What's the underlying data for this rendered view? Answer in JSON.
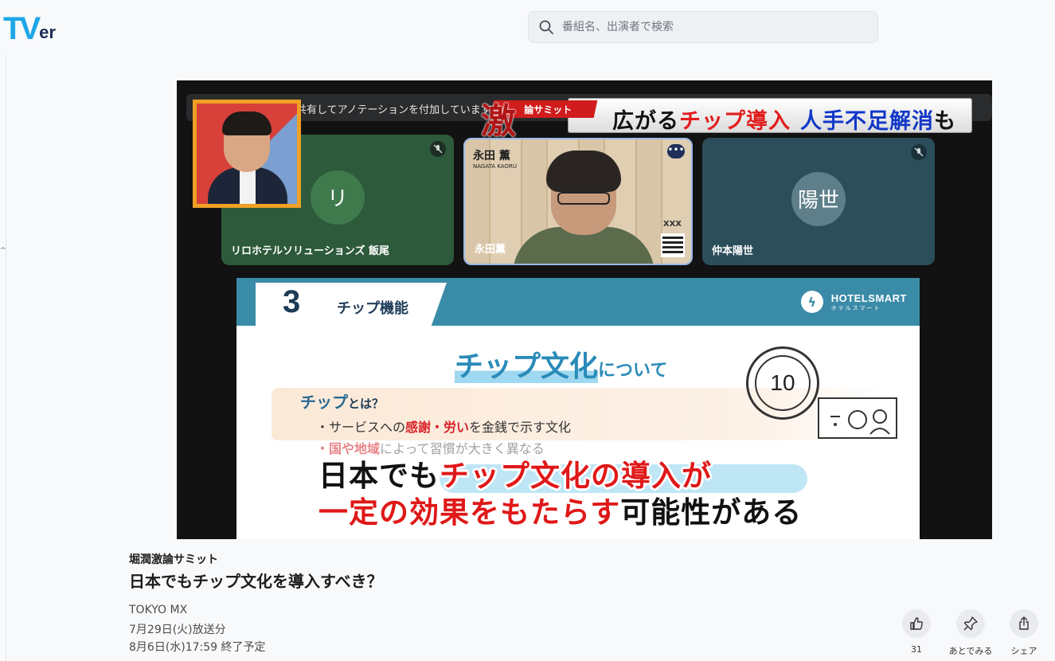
{
  "header": {
    "logo": {
      "t": "T",
      "v": "V",
      "er": "er"
    },
    "search": {
      "placeholder": "番組名、出演者で検索"
    }
  },
  "player": {
    "share_note": "共有してアノテーションを付加しています",
    "banner": {
      "badge": "論サミット",
      "kanji": "激",
      "part1": "広がる",
      "part2": "チップ導入",
      "part3": "人手不足解消",
      "part4": "も"
    },
    "participants": [
      {
        "initial": "リ",
        "name": "リロホテルソリューションズ 飯尾"
      },
      {
        "name": "永田薫",
        "card_name": "永田 薫",
        "card_sub": "NAGATA KAORU",
        "logo_text": "XXX"
      },
      {
        "initial": "陽世",
        "name": "仲本陽世"
      }
    ],
    "slide": {
      "number": "3",
      "section": "チップ機能",
      "brand": "HOTELSMART",
      "brand_sub": "ホテルスマート",
      "title_big": "チップ文化",
      "title_small": "について",
      "coin": "10",
      "def_title": "チップ",
      "def_title_suffix": "とは？",
      "line1_pre": "・サービスへの",
      "line1_hl": "感謝・労い",
      "line1_post": "を金銭で示す文化",
      "line2_hl": "・国や地域",
      "line2_post": "によって習慣が大きく異なる"
    },
    "caption": {
      "l1_black": "日本でも",
      "l1_red": "チップ文化の導入が",
      "l2_red": "一定の効果をもたらす",
      "l2_black": "可能性がある"
    }
  },
  "info": {
    "series": "堀潤激論サミット",
    "title": "日本でもチップ文化を導入すべき？",
    "broadcaster": "TOKYO MX",
    "aired": "7月29日(火)放送分",
    "ends": "8月6日(水)17:59 終了予定"
  },
  "actions": [
    {
      "icon": "thumbs-up-icon",
      "label": "31"
    },
    {
      "icon": "pin-icon",
      "label": "あとでみる"
    },
    {
      "icon": "share-icon",
      "label": "シェア"
    }
  ],
  "colors": {
    "brand_blue": "#1ea7e8",
    "brand_navy": "#1b2b57",
    "caption_red": "#e01818",
    "slide_teal": "#3a8ba8"
  }
}
